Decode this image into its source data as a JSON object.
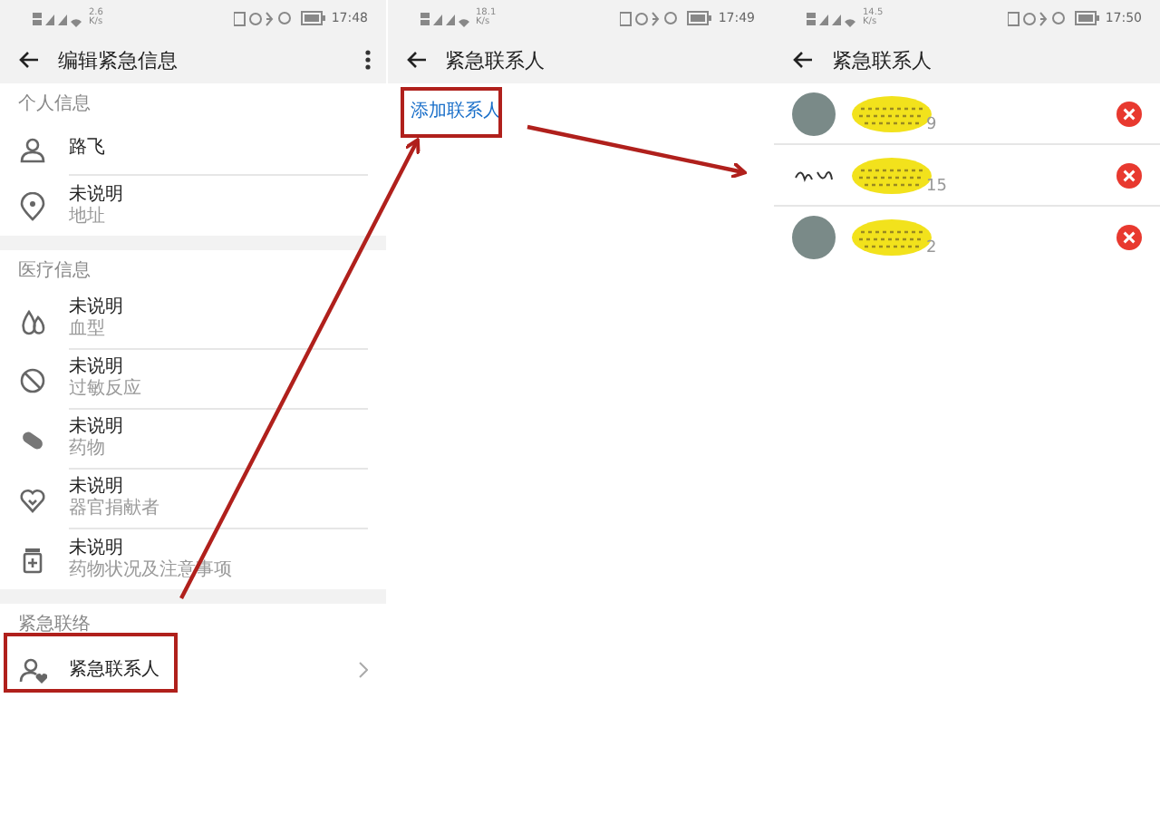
{
  "screens": [
    {
      "kind": "edit",
      "status_bar": {
        "speed": "2.6 K/s",
        "time": "17:48"
      },
      "title": "编辑紧急信息",
      "sections": [
        {
          "label": "个人信息",
          "items": [
            {
              "kind": "person",
              "title": "路飞"
            },
            {
              "kind": "pin",
              "title": "未说明",
              "subtitle": "地址"
            }
          ]
        },
        {
          "label": "医疗信息",
          "items": [
            {
              "kind": "drop",
              "title": "未说明",
              "subtitle": "血型"
            },
            {
              "kind": "ban",
              "title": "未说明",
              "subtitle": "过敏反应"
            },
            {
              "kind": "pill",
              "title": "未说明",
              "subtitle": "药物"
            },
            {
              "kind": "heart",
              "title": "未说明",
              "subtitle": "器官捐献者"
            },
            {
              "kind": "bottle",
              "title": "未说明",
              "subtitle": "药物状况及注意事项"
            }
          ]
        },
        {
          "label": "紧急联络",
          "items": [
            {
              "kind": "contact",
              "title": "紧急联系人"
            }
          ]
        }
      ]
    },
    {
      "kind": "add",
      "status_bar": {
        "speed": "18.1 K/s",
        "time": "17:49"
      },
      "title": "紧急联系人",
      "add_link": "添加联系人"
    },
    {
      "kind": "list",
      "status_bar": {
        "speed": "14.5 K/s",
        "time": "17:50"
      },
      "title": "紧急联系人",
      "contacts": [
        {
          "kind": "photo",
          "number_tail": "9"
        },
        {
          "kind": "signature",
          "number_tail": "15"
        },
        {
          "kind": "photo",
          "number_tail": "2"
        }
      ]
    }
  ]
}
